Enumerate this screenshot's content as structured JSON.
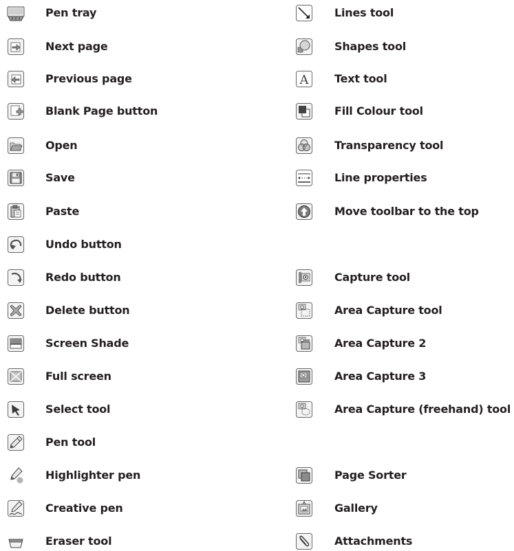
{
  "left_column": [
    {
      "label": "Pen tray",
      "icon": "pen-tray-icon"
    },
    {
      "label": "Next page",
      "icon": "next-page-icon"
    },
    {
      "label": "Previous page",
      "icon": "previous-page-icon"
    },
    {
      "label": "Blank Page button",
      "icon": "blank-page-icon"
    },
    {
      "label": "Open",
      "icon": "open-folder-icon"
    },
    {
      "label": "Save",
      "icon": "save-floppy-icon"
    },
    {
      "label": "Paste",
      "icon": "paste-clipboard-icon"
    },
    {
      "label": "Undo button",
      "icon": "undo-icon"
    },
    {
      "label": "Redo button",
      "icon": "redo-icon"
    },
    {
      "label": "Delete button",
      "icon": "delete-x-icon"
    },
    {
      "label": "Screen Shade",
      "icon": "screen-shade-icon"
    },
    {
      "label": "Full screen",
      "icon": "full-screen-icon"
    },
    {
      "label": "Select tool",
      "icon": "select-arrow-icon"
    },
    {
      "label": "Pen tool",
      "icon": "pen-icon"
    },
    {
      "label": "Highlighter pen",
      "icon": "highlighter-icon"
    },
    {
      "label": "Creative pen",
      "icon": "creative-pen-icon"
    },
    {
      "label": "Eraser tool",
      "icon": "eraser-icon"
    }
  ],
  "right_column": [
    {
      "label": "Lines tool",
      "icon": "lines-icon"
    },
    {
      "label": "Shapes tool",
      "icon": "shapes-icon"
    },
    {
      "label": "Text tool",
      "icon": "text-a-icon"
    },
    {
      "label": "Fill Colour tool",
      "icon": "fill-colour-icon"
    },
    {
      "label": "Transparency tool",
      "icon": "transparency-icon"
    },
    {
      "label": "Line properties",
      "icon": "line-properties-icon"
    },
    {
      "label": "Move toolbar to the top",
      "icon": "move-toolbar-up-icon"
    },
    {
      "label": "Capture tool",
      "icon": "camera-capture-icon"
    },
    {
      "label": "Area Capture tool",
      "icon": "area-capture-icon"
    },
    {
      "label": "Area Capture 2",
      "icon": "area-capture-2-icon"
    },
    {
      "label": "Area Capture 3",
      "icon": "area-capture-3-icon"
    },
    {
      "label": "Area Capture (freehand) tool",
      "icon": "area-capture-freehand-icon"
    },
    {
      "label": "Page Sorter",
      "icon": "page-sorter-icon"
    },
    {
      "label": "Gallery",
      "icon": "gallery-icon"
    },
    {
      "label": "Attachments",
      "icon": "attachments-paperclip-icon"
    }
  ]
}
